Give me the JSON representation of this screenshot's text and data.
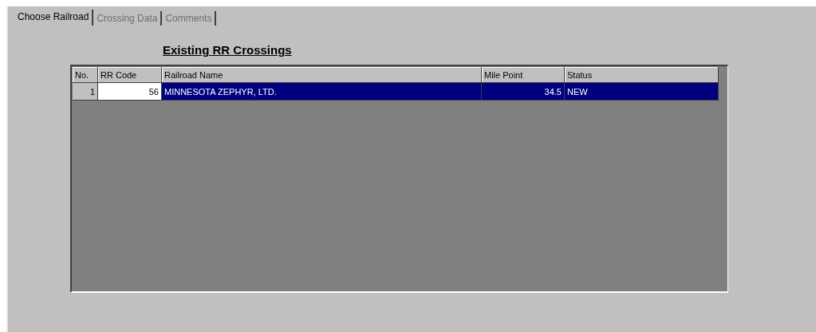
{
  "tabs": [
    {
      "label": "Choose Railroad",
      "selected": true,
      "disabled": false
    },
    {
      "label": "Crossing Data",
      "selected": false,
      "disabled": true
    },
    {
      "label": "Comments",
      "selected": false,
      "disabled": true
    }
  ],
  "heading": "Existing RR Crossings",
  "table": {
    "columns": [
      "No.",
      "RR Code",
      "Railroad Name",
      "Mile Point",
      "Status"
    ],
    "rows": [
      {
        "cells": [
          "1",
          "56",
          "MINNESOTA ZEPHYR, LTD.",
          "34.5",
          "NEW"
        ],
        "selected": true
      }
    ]
  }
}
